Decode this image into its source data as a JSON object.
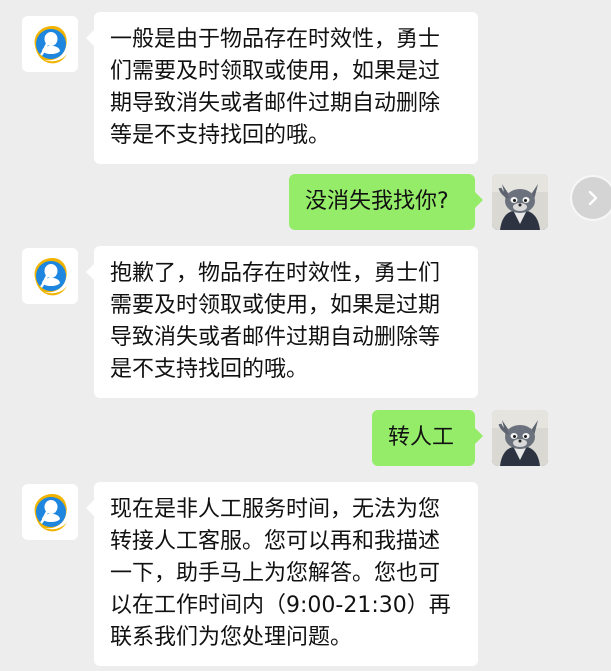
{
  "colors": {
    "background": "#ededed",
    "bot_bubble": "#ffffff",
    "user_bubble": "#95ec69",
    "bot_avatar_blue": "#1f86df",
    "bot_avatar_gold": "#f0b400"
  },
  "messages": [
    {
      "sender": "bot",
      "lines": [
        "一般是由于物品存在时效性，勇士",
        "们需要及时领取或使用，如果是过",
        "期导致消失或者邮件过期自动删除",
        "等是不支持找回的哦。"
      ]
    },
    {
      "sender": "user",
      "lines": [
        "没消失我找你?"
      ]
    },
    {
      "sender": "bot",
      "lines": [
        "抱歉了，物品存在时效性，勇士们",
        "需要及时领取或使用，如果是过期",
        "导致消失或者邮件过期自动删除等",
        "是不支持找回的哦。"
      ]
    },
    {
      "sender": "user",
      "lines": [
        "转人工"
      ]
    },
    {
      "sender": "bot",
      "lines": [
        "现在是非人工服务时间，无法为您",
        "转接人工客服。您可以再和我描述",
        "一下，助手马上为您解答。您也可",
        "以在工作时间内（9:00-21:30）再",
        "联系我们为您处理问题。"
      ]
    }
  ],
  "icons": {
    "bot_avatar": "assistant-logo-icon",
    "user_avatar": "cartoon-cat-avatar-icon",
    "side_button": "chevron-right-icon"
  }
}
